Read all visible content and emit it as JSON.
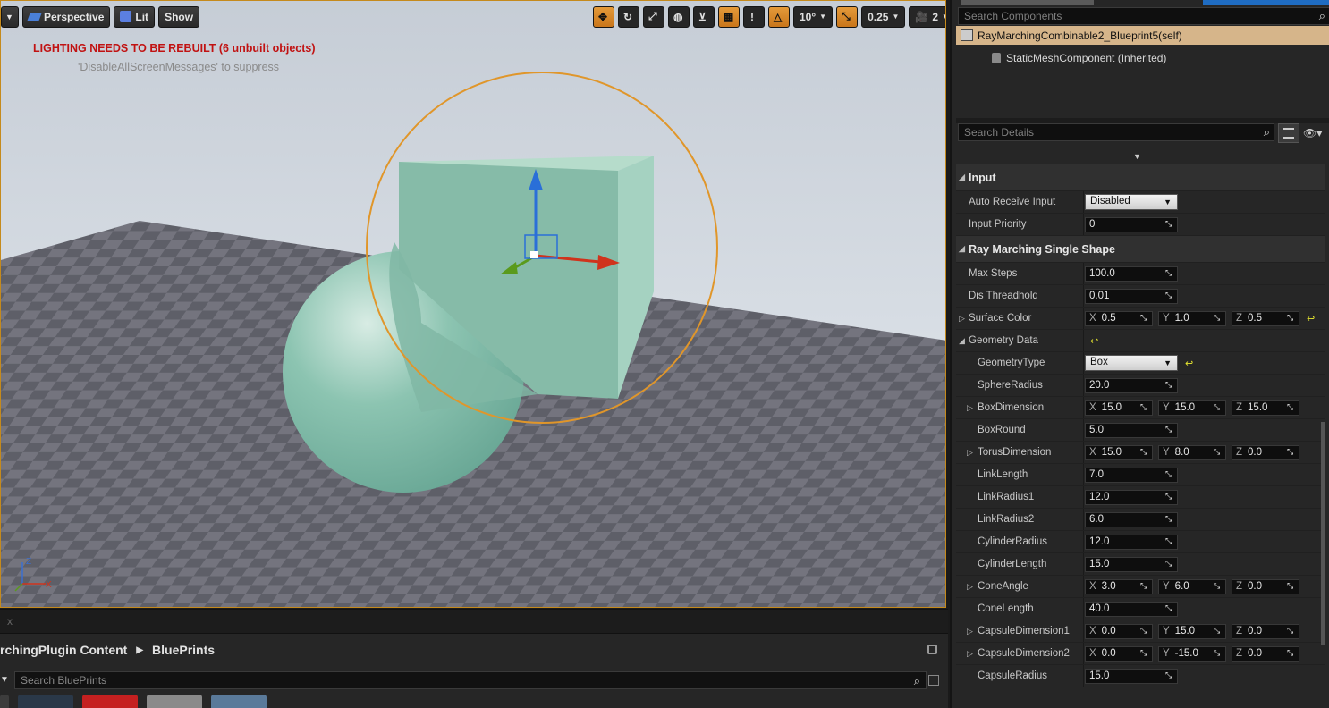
{
  "viewport": {
    "toolbar_left": [
      {
        "label": "Perspective",
        "icon": "perspective-icon"
      },
      {
        "label": "Lit",
        "icon": "lit-icon"
      },
      {
        "label": "Show"
      }
    ],
    "toolbar_right": {
      "rotation_snap": "10°",
      "scale_snap": "0.25",
      "camera_speed": "2",
      "translate_icon": "translate-icon",
      "rotate_icon": "rotate-icon",
      "scale_icon": "scale-icon",
      "world_icon": "world-icon",
      "surface_snap_icon": "surface-snap-icon",
      "grid_icon": "grid-icon",
      "grid_value": "!",
      "angle_icon": "angle-snap-icon",
      "scale_snap_icon": "scale-snap-icon",
      "camera_icon": "camera-speed-icon",
      "maximize_icon": "maximize-icon"
    },
    "warning": "LIGHTING NEEDS TO BE REBUILT (6 unbuilt objects)",
    "suppress_hint": "'DisableAllScreenMessages' to suppress",
    "axis_labels": {
      "z": "Z",
      "x": "X"
    }
  },
  "strip": {
    "close": "x"
  },
  "content_browser": {
    "path": [
      "rchingPlugin Content",
      "BluePrints"
    ],
    "search_placeholder": "Search BluePrints",
    "thumb_count": 5
  },
  "details": {
    "components_search_placeholder": "Search Components",
    "self_component": "RayMarchingCombinable2_Blueprint5(self)",
    "child_component": "StaticMeshComponent (Inherited)",
    "details_search_placeholder": "Search Details",
    "categories": [
      {
        "title": "Input",
        "rows": [
          {
            "name": "Auto Receive Input",
            "type": "combo",
            "value": "Disabled"
          },
          {
            "name": "Input Priority",
            "type": "num",
            "value": "0"
          }
        ]
      },
      {
        "title": "Ray Marching Single Shape",
        "rows": [
          {
            "name": "Max Steps",
            "type": "num",
            "value": "100.0"
          },
          {
            "name": "Dis Threadhold",
            "type": "num",
            "value": "0.01"
          },
          {
            "name": "Surface Color",
            "type": "vec",
            "expandable": true,
            "x": "0.5",
            "y": "1.0",
            "z": "0.5",
            "reset": true
          },
          {
            "name": "Geometry Data",
            "type": "group",
            "expanded": true,
            "reset": true
          },
          {
            "name": "GeometryType",
            "type": "combo",
            "indent": true,
            "value": "Box",
            "reset": true
          },
          {
            "name": "SphereRadius",
            "type": "num",
            "indent": true,
            "value": "20.0"
          },
          {
            "name": "BoxDimension",
            "type": "vec",
            "indent": true,
            "expandable": true,
            "x": "15.0",
            "y": "15.0",
            "z": "15.0"
          },
          {
            "name": "BoxRound",
            "type": "num",
            "indent": true,
            "value": "5.0"
          },
          {
            "name": "TorusDimension",
            "type": "vec",
            "indent": true,
            "expandable": true,
            "x": "15.0",
            "y": "8.0",
            "z": "0.0"
          },
          {
            "name": "LinkLength",
            "type": "num",
            "indent": true,
            "value": "7.0"
          },
          {
            "name": "LinkRadius1",
            "type": "num",
            "indent": true,
            "value": "12.0"
          },
          {
            "name": "LinkRadius2",
            "type": "num",
            "indent": true,
            "value": "6.0"
          },
          {
            "name": "CylinderRadius",
            "type": "num",
            "indent": true,
            "value": "12.0"
          },
          {
            "name": "CylinderLength",
            "type": "num",
            "indent": true,
            "value": "15.0"
          },
          {
            "name": "ConeAngle",
            "type": "vec",
            "indent": true,
            "expandable": true,
            "x": "3.0",
            "y": "6.0",
            "z": "0.0"
          },
          {
            "name": "ConeLength",
            "type": "num",
            "indent": true,
            "value": "40.0"
          },
          {
            "name": "CapsuleDimension1",
            "type": "vec",
            "indent": true,
            "expandable": true,
            "x": "0.0",
            "y": "15.0",
            "z": "0.0"
          },
          {
            "name": "CapsuleDimension2",
            "type": "vec",
            "indent": true,
            "expandable": true,
            "x": "0.0",
            "y": "-15.0",
            "z": "0.0"
          },
          {
            "name": "CapsuleRadius",
            "type": "num",
            "indent": true,
            "value": "15.0"
          }
        ]
      }
    ]
  },
  "colors": {
    "selection_outline": "#e0962a",
    "shape_fill": "#7fb8a4",
    "warning_red": "#c11212",
    "component_highlight": "#d6b58a"
  }
}
